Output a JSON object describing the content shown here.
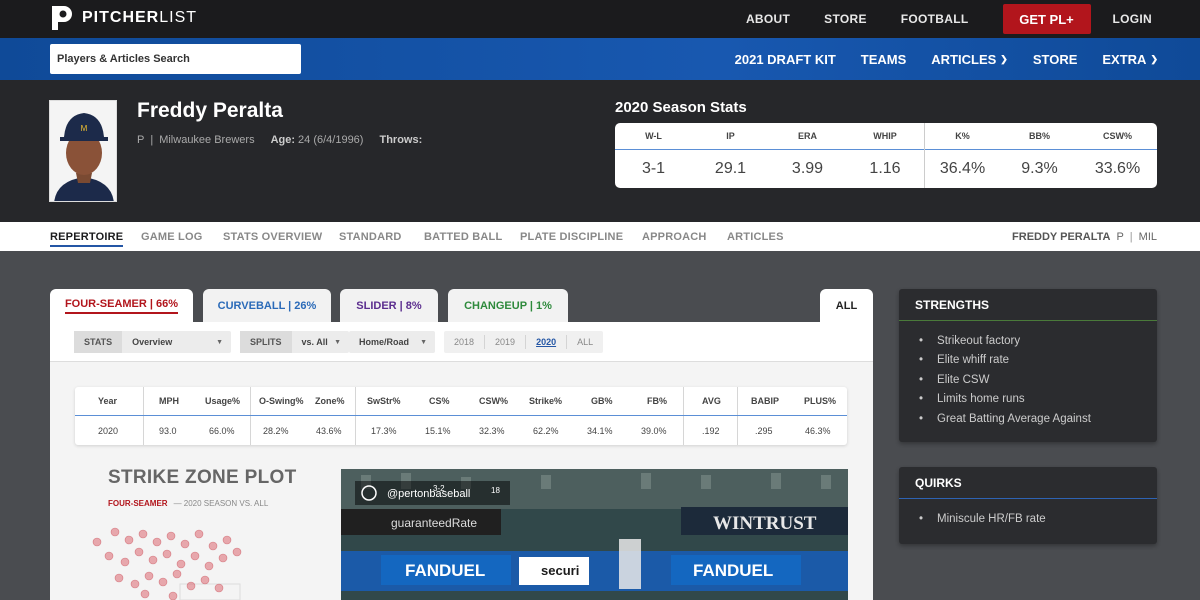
{
  "site": {
    "logo_text_bold": "PITCHER",
    "logo_text_light": "LIST",
    "top_nav": [
      "ABOUT",
      "STORE",
      "FOOTBALL"
    ],
    "cta": "GET PL+",
    "login": "LOGIN"
  },
  "subnav": {
    "search_placeholder": "Players & Articles Search",
    "items": [
      "2021 DRAFT KIT",
      "TEAMS",
      "ARTICLES",
      "STORE",
      "EXTRA"
    ]
  },
  "player": {
    "name": "Freddy Peralta",
    "position": "P",
    "team": "Milwaukee Brewers",
    "age_label": "Age:",
    "age_value": "24 (6/4/1996)",
    "throws_label": "Throws:"
  },
  "season_stats": {
    "title": "2020 Season Stats",
    "headers": [
      "W-L",
      "IP",
      "ERA",
      "WHIP",
      "K%",
      "BB%",
      "CSW%"
    ],
    "values": [
      "3-1",
      "29.1",
      "3.99",
      "1.16",
      "36.4%",
      "9.3%",
      "33.6%"
    ]
  },
  "tabs": {
    "items": [
      "REPERTOIRE",
      "GAME LOG",
      "STATS OVERVIEW",
      "STANDARD",
      "BATTED BALL",
      "PLATE DISCIPLINE",
      "APPROACH",
      "ARTICLES"
    ],
    "active": "REPERTOIRE",
    "right_name": "FREDDY PERALTA",
    "right_pos": "P",
    "right_team": "MIL"
  },
  "pitch_tabs": [
    {
      "label": "FOUR-SEAMER | 66%",
      "color": "#b2151c"
    },
    {
      "label": "CURVEBALL | 26%",
      "color": "#2a6ab8"
    },
    {
      "label": "SLIDER | 8%",
      "color": "#5b2d8e"
    },
    {
      "label": "CHANGEUP | 1%",
      "color": "#2e8a3c"
    }
  ],
  "all_tab": "ALL",
  "controls": {
    "stats_label": "STATS",
    "stats_value": "Overview",
    "splits_label": "SPLITS",
    "splits_value": "vs. All",
    "homeroad_value": "Home/Road",
    "years": [
      "2018",
      "2019",
      "2020",
      "ALL"
    ],
    "active_year": "2020"
  },
  "pitch_table": {
    "headers": [
      "Year",
      "MPH",
      "Usage%",
      "O-Swing%",
      "Zone%",
      "SwStr%",
      "CS%",
      "CSW%",
      "Strike%",
      "GB%",
      "FB%",
      "AVG",
      "BABIP",
      "PLUS%"
    ],
    "row": [
      "2020",
      "93.0",
      "66.0%",
      "28.2%",
      "43.6%",
      "17.3%",
      "15.1%",
      "32.3%",
      "62.2%",
      "34.1%",
      "39.0%",
      ".192",
      ".295",
      "46.3%"
    ]
  },
  "strike_zone": {
    "title": "STRIKE ZONE PLOT",
    "pitch": "FOUR-SEAMER",
    "subtitle": "— 2020 SEASON VS. ALL"
  },
  "video": {
    "handle": "@pertonbaseball",
    "banner1": "guaranteedRate",
    "banner2": "WINTRUST",
    "ad1": "FANDUEL",
    "ad2": "securi",
    "ad3": "FANDUEL",
    "score": "3-2",
    "count": "18"
  },
  "strengths": {
    "title": "STRENGTHS",
    "items": [
      "Strikeout factory",
      "Elite whiff rate",
      "Elite CSW",
      "Limits home runs",
      "Great Batting Average Against"
    ]
  },
  "quirks": {
    "title": "QUIRKS",
    "items": [
      "Miniscule HR/FB rate"
    ]
  }
}
